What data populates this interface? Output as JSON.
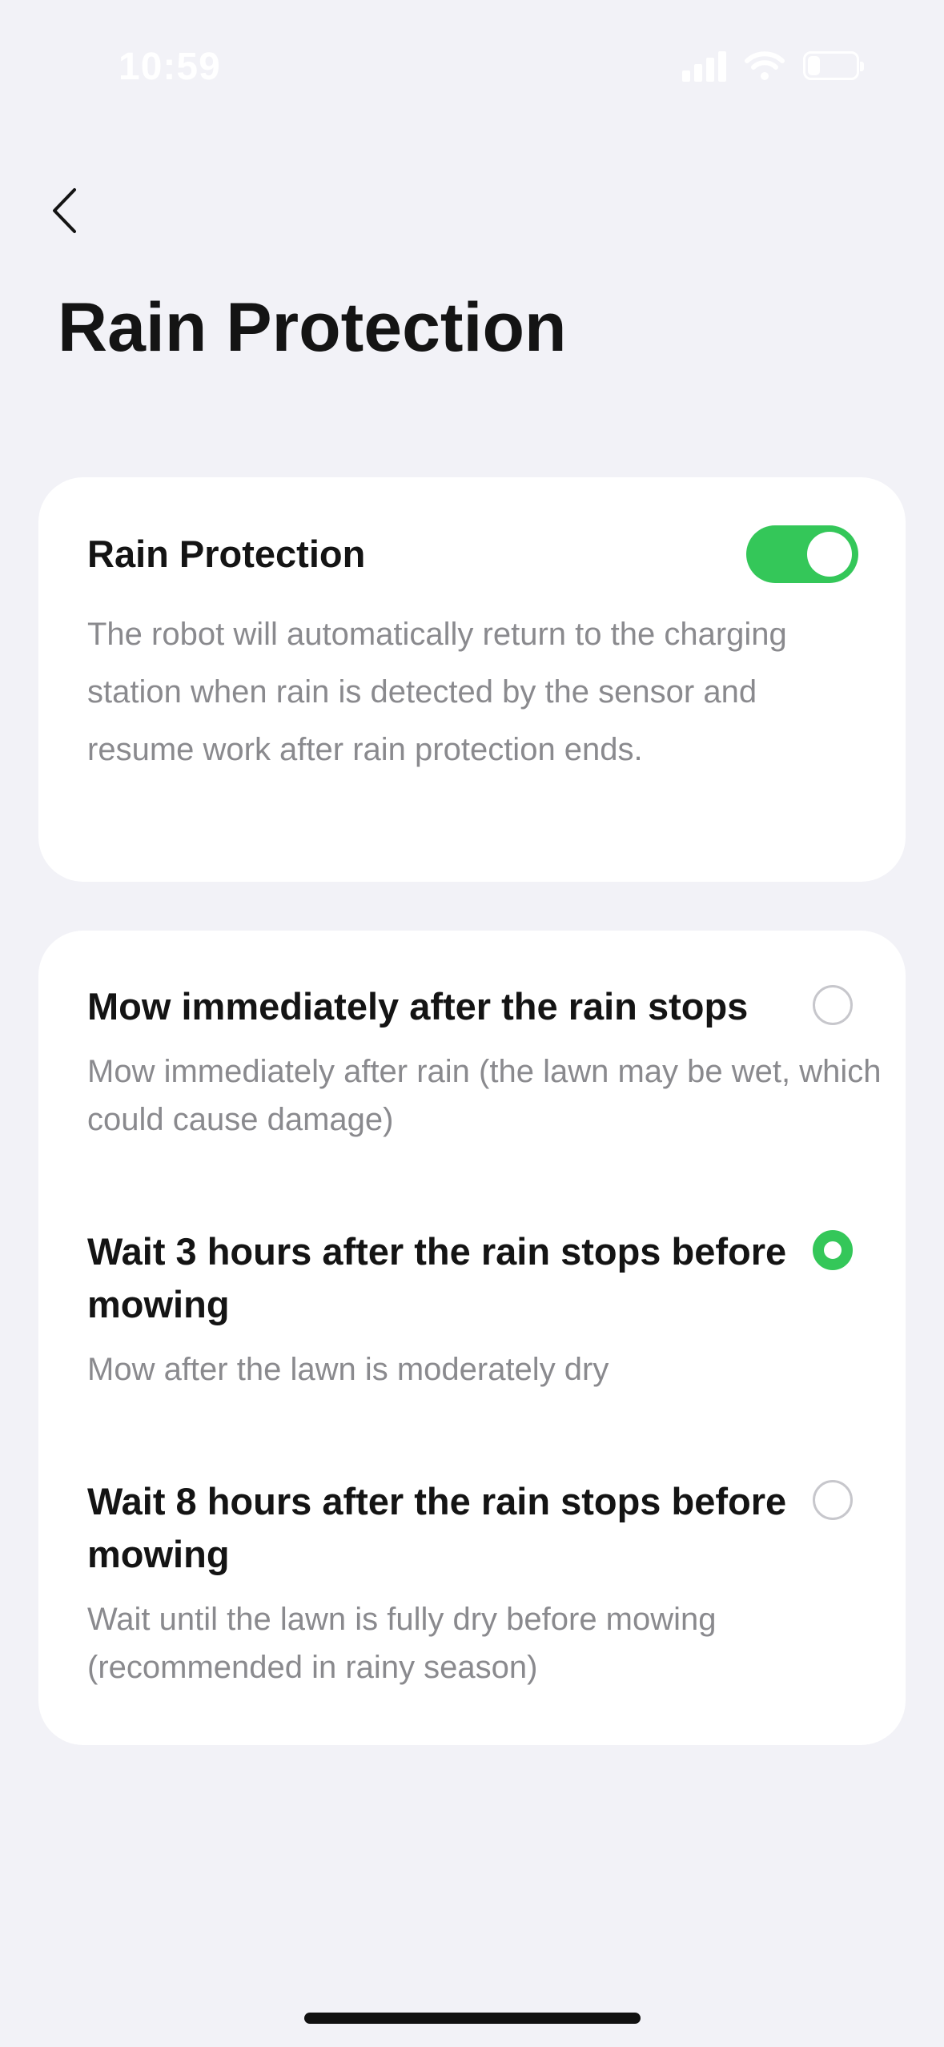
{
  "status_bar": {
    "time": "10:59",
    "battery_level": "24",
    "icons": [
      "cellular-signal-icon",
      "wifi-icon",
      "battery-icon"
    ]
  },
  "header": {
    "back_icon": "chevron-left-icon",
    "title": "Rain Protection"
  },
  "rain_protection": {
    "label": "Rain Protection",
    "enabled": true,
    "description": "The robot will automatically return to the charging station when rain is detected by the sensor and resume work after rain protection ends."
  },
  "options": [
    {
      "title": "Mow immediately after the rain stops",
      "description": "Mow immediately after rain (the lawn may be wet, which could cause damage)",
      "selected": false
    },
    {
      "title": "Wait 3 hours after the rain stops before mowing",
      "description": "Mow after the lawn is moderately dry",
      "selected": true
    },
    {
      "title": "Wait 8 hours after the rain stops before mowing",
      "description": "Wait until the lawn is fully dry before mowing (recommended in rainy season)",
      "selected": false
    }
  ],
  "colors": {
    "accent": "#34c759",
    "background": "#f2f2f7",
    "card": "#ffffff",
    "secondary_text": "#8a8a8e"
  }
}
